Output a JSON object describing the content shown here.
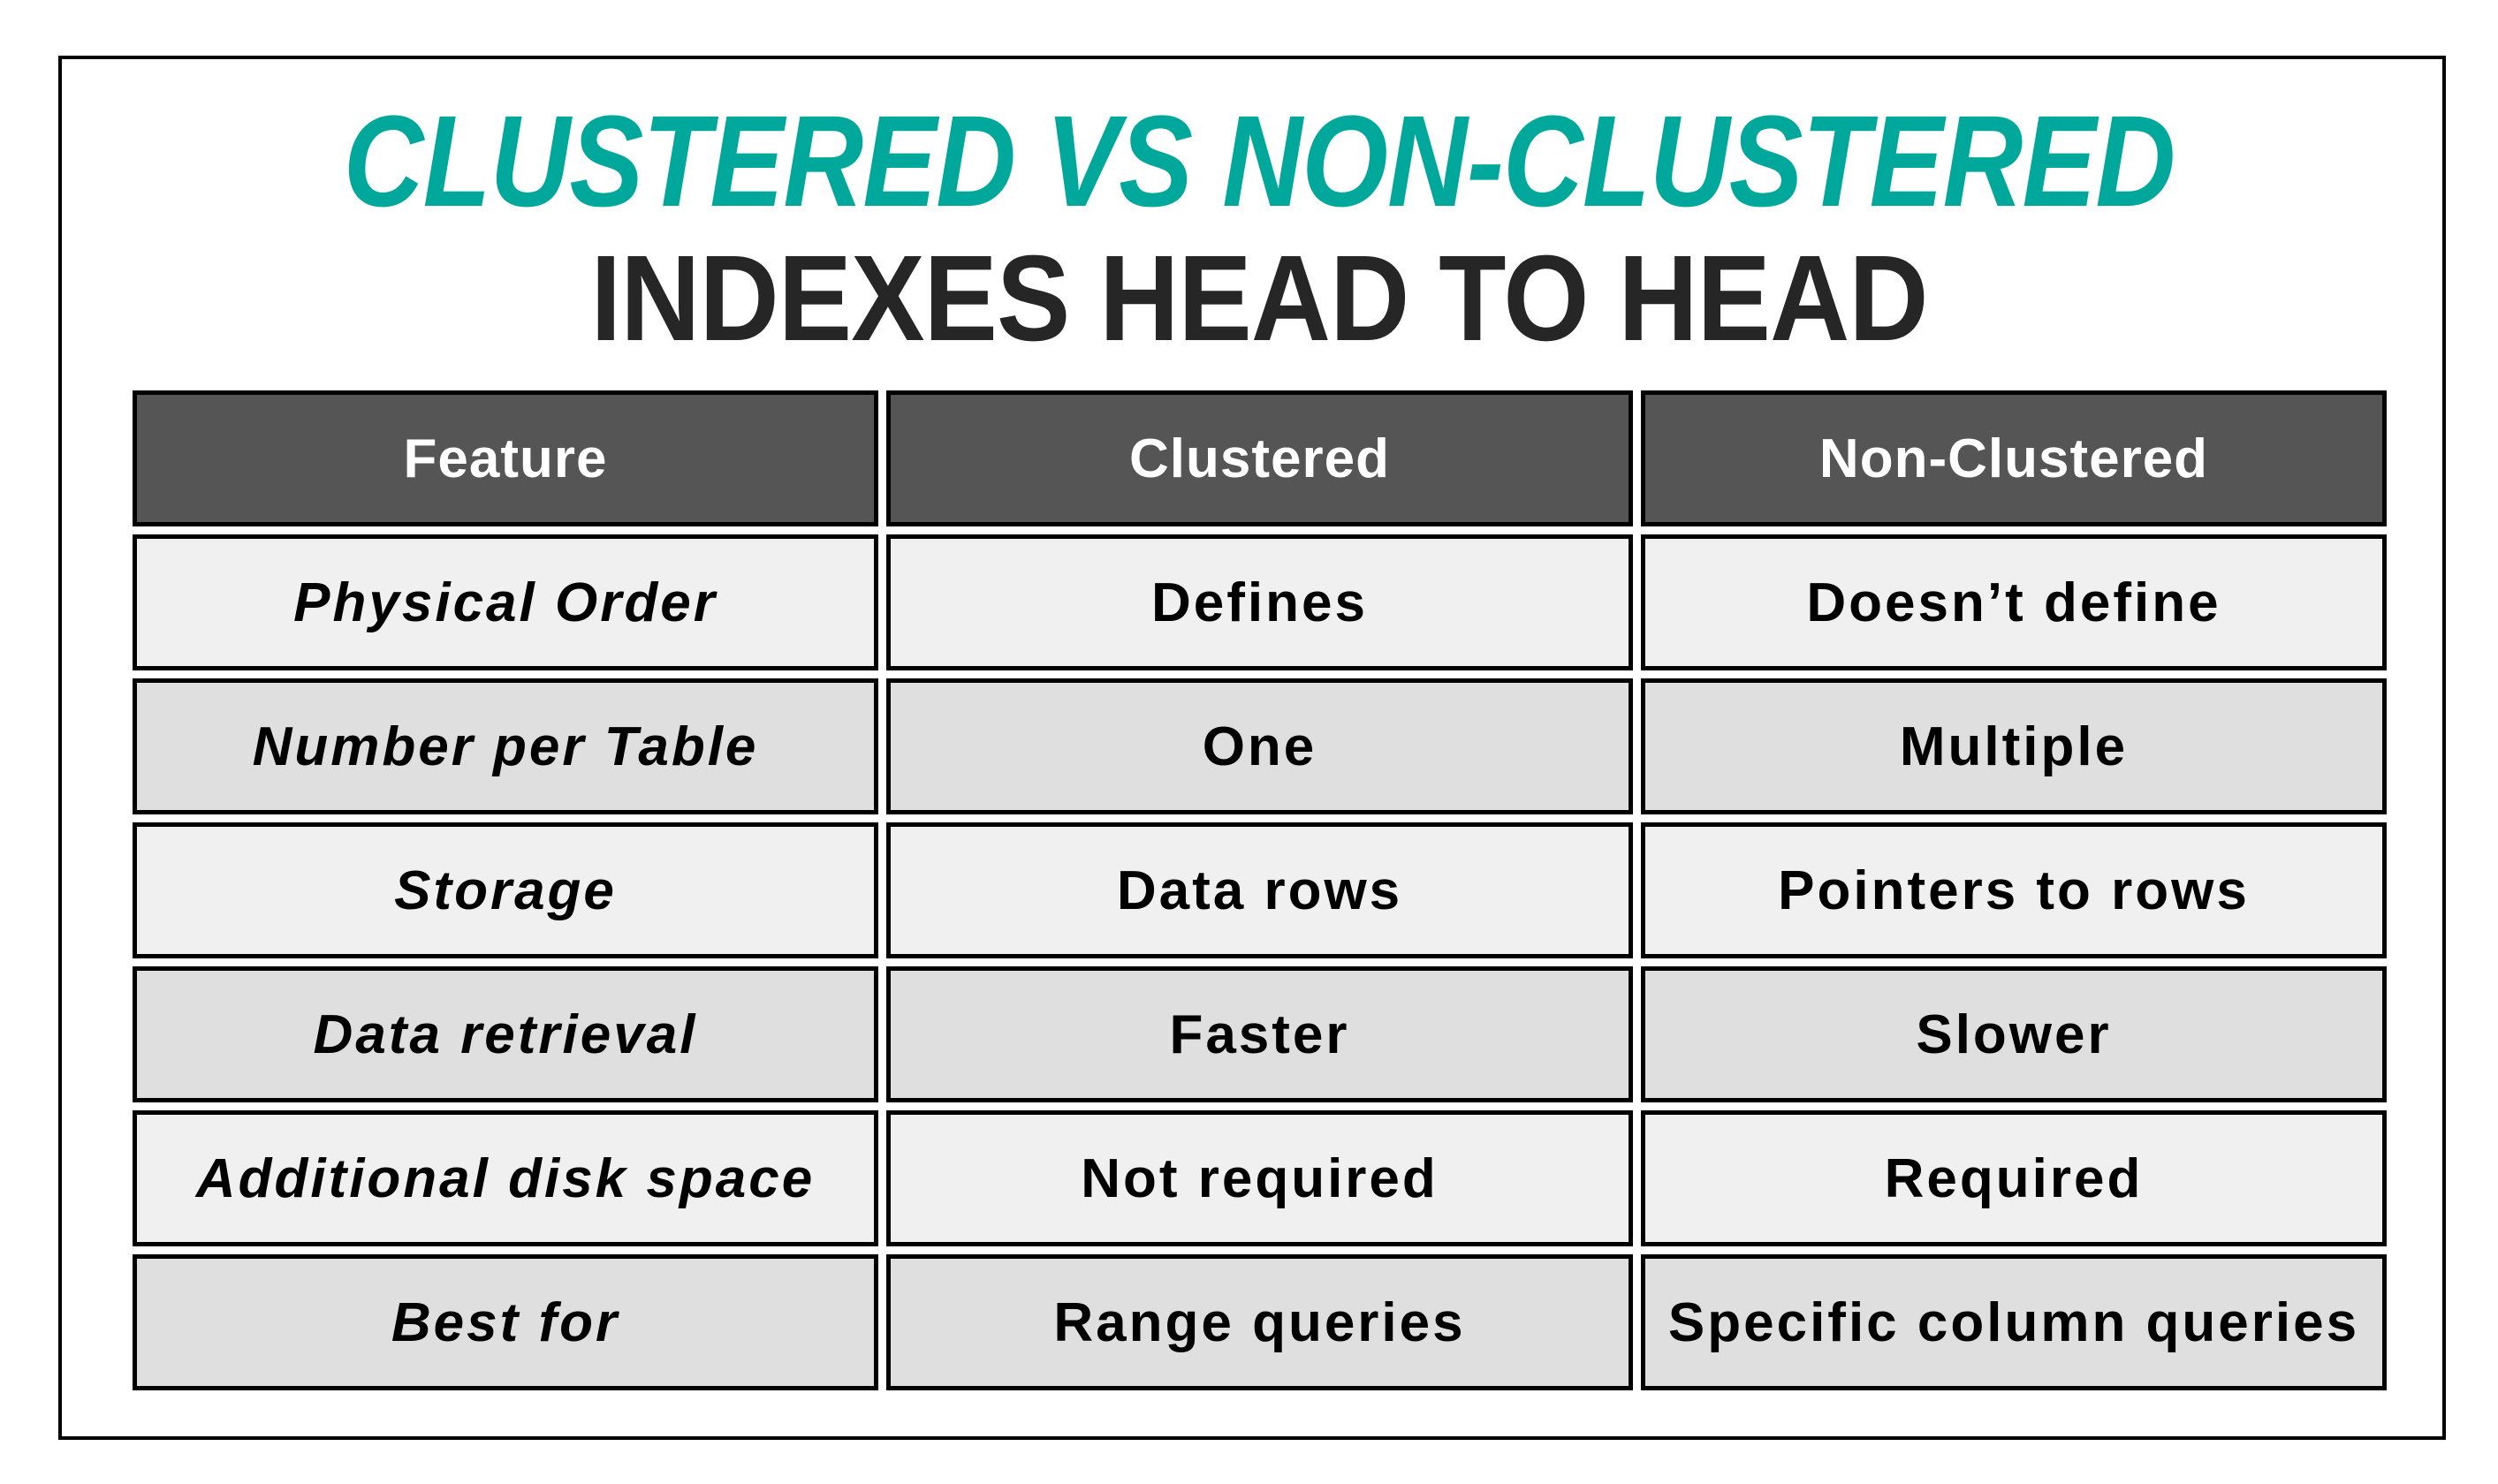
{
  "title": {
    "line1": "CLUSTERED VS NON-CLUSTERED",
    "line2": "INDEXES HEAD TO HEAD",
    "line1_color": "#00a89c",
    "line2_color": "#262626"
  },
  "table": {
    "header_color": "#555555",
    "row_colors": [
      "#f0f0f0",
      "#dfdfdf"
    ],
    "columns": [
      "Feature",
      "Clustered",
      "Non-Clustered"
    ],
    "rows": [
      {
        "feature": "Physical Order",
        "clustered": "Defines",
        "non_clustered": "Doesn’t define"
      },
      {
        "feature": "Number per Table",
        "clustered": "One",
        "non_clustered": "Multiple"
      },
      {
        "feature": "Storage",
        "clustered": "Data rows",
        "non_clustered": "Pointers to rows"
      },
      {
        "feature": "Data retrieval",
        "clustered": "Faster",
        "non_clustered": "Slower"
      },
      {
        "feature": "Additional disk space",
        "clustered": "Not required",
        "non_clustered": "Required"
      },
      {
        "feature": "Best for",
        "clustered": "Range queries",
        "non_clustered": "Specific column queries"
      }
    ]
  }
}
